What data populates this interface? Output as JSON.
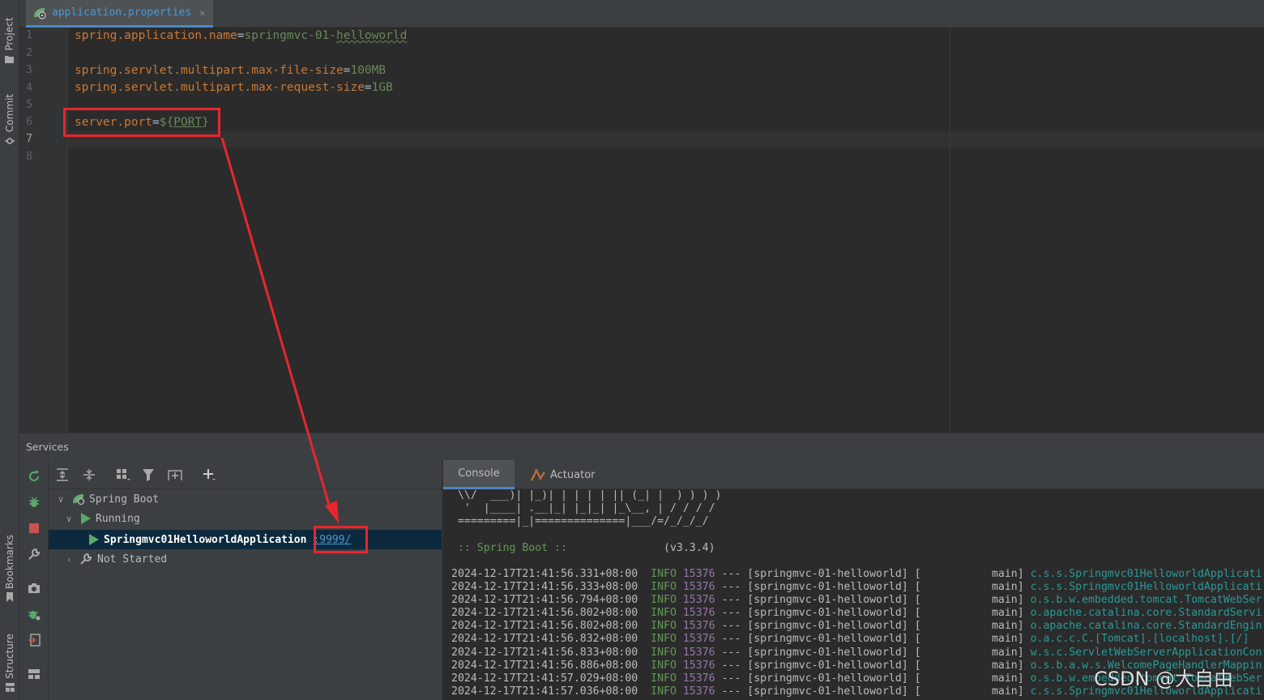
{
  "left_strip": {
    "project": "Project",
    "commit": "Commit",
    "bookmarks": "Bookmarks",
    "structure": "Structure"
  },
  "editor_tab": {
    "label": "application.properties",
    "icon": "spring-properties-icon"
  },
  "editor": {
    "line_numbers": [
      "1",
      "2",
      "3",
      "4",
      "5",
      "6",
      "7",
      "8"
    ],
    "lines": {
      "l1_key": "spring.application.name",
      "l1_eq": "=",
      "l1_val_a": "springmvc-01-",
      "l1_val_b": "helloworld",
      "l3_key": "spring.servlet.multipart.max-file-size",
      "l3_eq": "=",
      "l3_val": "100MB",
      "l4_key": "spring.servlet.multipart.max-request-size",
      "l4_eq": "=",
      "l4_val": "1GB",
      "l6_key": "server.port",
      "l6_eq": "=",
      "l6_open": "${",
      "l6_var": "PORT",
      "l6_close": "}"
    }
  },
  "services": {
    "title": "Services",
    "tree": {
      "root": "Spring Boot",
      "running": "Running",
      "app": "Springmvc01HelloworldApplication",
      "port": ":9999/",
      "not_started": "Not Started"
    }
  },
  "console_tabs": {
    "console": "Console",
    "actuator": "Actuator"
  },
  "console": {
    "banner": [
      " \\\\/  ___)| |_)| | | | | || (_| |  ) ) ) )",
      "  '  |____| .__|_| |_|_| |_\\__, | / / / /",
      " =========|_|==============|___/=/_/_/_/"
    ],
    "spring_boot_label": " :: Spring Boot ::",
    "version": "(v3.3.4)",
    "logs": [
      {
        "ts": "2024-12-17T21:41:56.331+08:00",
        "level": "INFO",
        "pid": "15376",
        "rest": " --- [springmvc-01-helloworld] [           main] ",
        "logger": "c.s.s.Springmvc01HelloworldApplicati"
      },
      {
        "ts": "2024-12-17T21:41:56.333+08:00",
        "level": "INFO",
        "pid": "15376",
        "rest": " --- [springmvc-01-helloworld] [           main] ",
        "logger": "c.s.s.Springmvc01HelloworldApplicati"
      },
      {
        "ts": "2024-12-17T21:41:56.794+08:00",
        "level": "INFO",
        "pid": "15376",
        "rest": " --- [springmvc-01-helloworld] [           main] ",
        "logger": "o.s.b.w.embedded.tomcat.TomcatWebSer"
      },
      {
        "ts": "2024-12-17T21:41:56.802+08:00",
        "level": "INFO",
        "pid": "15376",
        "rest": " --- [springmvc-01-helloworld] [           main] ",
        "logger": "o.apache.catalina.core.StandardServi"
      },
      {
        "ts": "2024-12-17T21:41:56.802+08:00",
        "level": "INFO",
        "pid": "15376",
        "rest": " --- [springmvc-01-helloworld] [           main] ",
        "logger": "o.apache.catalina.core.StandardEngin"
      },
      {
        "ts": "2024-12-17T21:41:56.832+08:00",
        "level": "INFO",
        "pid": "15376",
        "rest": " --- [springmvc-01-helloworld] [           main] ",
        "logger": "o.a.c.c.C.[Tomcat].[localhost].[/]"
      },
      {
        "ts": "2024-12-17T21:41:56.833+08:00",
        "level": "INFO",
        "pid": "15376",
        "rest": " --- [springmvc-01-helloworld] [           main] ",
        "logger": "w.s.c.ServletWebServerApplicationCon"
      },
      {
        "ts": "2024-12-17T21:41:56.886+08:00",
        "level": "INFO",
        "pid": "15376",
        "rest": " --- [springmvc-01-helloworld] [           main] ",
        "logger": "o.s.b.a.w.s.WelcomePageHandlerMappin"
      },
      {
        "ts": "2024-12-17T21:41:57.029+08:00",
        "level": "INFO",
        "pid": "15376",
        "rest": " --- [springmvc-01-helloworld] [           main] ",
        "logger": "o.s.b.w.embedded.tomcat.TomcatWebSer"
      },
      {
        "ts": "2024-12-17T21:41:57.036+08:00",
        "level": "INFO",
        "pid": "15376",
        "rest": " --- [springmvc-01-helloworld] [           main] ",
        "logger": "c.s.s.Springmvc01HelloworldApplicati"
      }
    ]
  },
  "watermark": "CSDN @大自由",
  "colors": {
    "keyword": "#cc7832",
    "value": "#6a8759",
    "annotation_red": "#e8262c",
    "link": "#4a9ad4",
    "pid": "#9876aa",
    "logger": "#299999"
  }
}
